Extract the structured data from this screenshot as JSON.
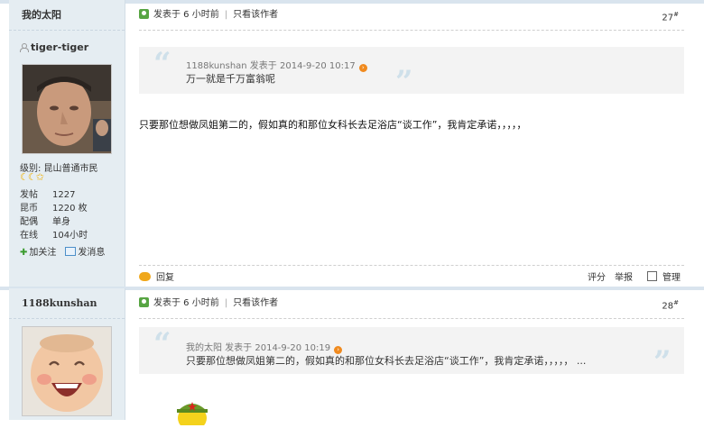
{
  "post1": {
    "sidebar_title": "我的太阳",
    "username": "tiger-tiger",
    "level": "级别: 昆山普通市民",
    "level_icons": "☾☾✩",
    "stats": [
      {
        "k": "发帖",
        "v": "1227"
      },
      {
        "k": "昆币",
        "v": "1220 枚"
      },
      {
        "k": "配偶",
        "v": "单身"
      },
      {
        "k": "在线",
        "v": "104小时"
      }
    ],
    "follow": "加关注",
    "message": "发消息",
    "posted": "发表于 6 小时前",
    "only_author": "只看该作者",
    "floor": "27",
    "floor_sup": "#",
    "quote_meta": "1188kunshan 发表于 2014-9-20 10:17",
    "quote_text": "万一就是千万富翁呢",
    "body": "只要那位想做凤姐第二的，假如真的和那位女科长去足浴店“谈工作”，我肯定承诺，，，，，",
    "reply": "回复",
    "rate": "评分",
    "report": "举报",
    "manage": "管理"
  },
  "post2": {
    "sidebar_title": "1188kunshan",
    "posted": "发表于 6 小时前",
    "only_author": "只看该作者",
    "floor": "28",
    "floor_sup": "#",
    "quote_meta": "我的太阳 发表于 2014-9-20 10:19",
    "quote_text": "只要那位想做凤姐第二的，假如真的和那位女科长去足浴店“谈工作”，我肯定承诺，，，，， ..."
  },
  "colors": {
    "sidebar_bg": "#e5edf2",
    "accent_green": "#57a543",
    "accent_orange": "#f08a1e",
    "quote_bg": "#f3f3f3"
  }
}
